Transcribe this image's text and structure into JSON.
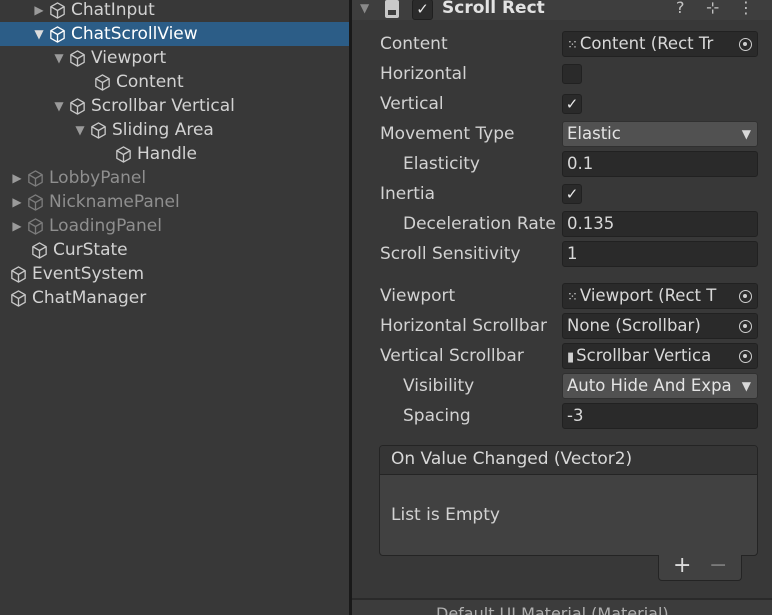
{
  "hierarchy": {
    "items": [
      {
        "label": "ChatInput",
        "state": "normal",
        "fold": "▶"
      },
      {
        "label": "ChatScrollView",
        "state": "selected",
        "fold": "▼"
      },
      {
        "label": "Viewport",
        "state": "normal",
        "fold": "▼"
      },
      {
        "label": "Content",
        "state": "normal",
        "fold": ""
      },
      {
        "label": "Scrollbar Vertical",
        "state": "normal",
        "fold": "▼"
      },
      {
        "label": "Sliding Area",
        "state": "normal",
        "fold": "▼"
      },
      {
        "label": "Handle",
        "state": "normal",
        "fold": ""
      },
      {
        "label": "LobbyPanel",
        "state": "inactive",
        "fold": "▶"
      },
      {
        "label": "NicknamePanel",
        "state": "inactive",
        "fold": "▶"
      },
      {
        "label": "LoadingPanel",
        "state": "inactive",
        "fold": "▶"
      },
      {
        "label": "CurState",
        "state": "normal",
        "fold": ""
      },
      {
        "label": "EventSystem",
        "state": "normal",
        "fold": ""
      },
      {
        "label": "ChatManager",
        "state": "normal",
        "fold": ""
      }
    ]
  },
  "inspector": {
    "component": {
      "title": "Scroll Rect",
      "fold": "▼",
      "enabled_mark": "✓",
      "help_glyph": "?",
      "preset_glyph": "⊹",
      "menu_glyph": "⋮"
    },
    "props": {
      "content": {
        "label": "Content",
        "value": "Content (Rect Tr",
        "ref_glyph": "⁙"
      },
      "horizontal": {
        "label": "Horizontal",
        "mark": ""
      },
      "vertical": {
        "label": "Vertical",
        "mark": "✓"
      },
      "movement_type": {
        "label": "Movement Type",
        "value": "Elastic",
        "arrow": "▼"
      },
      "elasticity": {
        "label": "Elasticity",
        "value": "0.1"
      },
      "inertia": {
        "label": "Inertia",
        "mark": "✓"
      },
      "deceleration_rate": {
        "label": "Deceleration Rate",
        "value": "0.135"
      },
      "scroll_sensitivity": {
        "label": "Scroll Sensitivity",
        "value": "1"
      },
      "viewport": {
        "label": "Viewport",
        "value": "Viewport (Rect T",
        "ref_glyph": "⁙"
      },
      "horizontal_scrollbar": {
        "label": "Horizontal Scrollbar",
        "value": "None (Scrollbar)"
      },
      "vertical_scrollbar": {
        "label": "Vertical Scrollbar",
        "value": "Scrollbar Vertica",
        "ref_glyph": "▮"
      },
      "visibility": {
        "label": "Visibility",
        "value": "Auto Hide And Expa",
        "arrow": "▼"
      },
      "spacing": {
        "label": "Spacing",
        "value": "-3"
      }
    },
    "event": {
      "title": "On Value Changed (Vector2)",
      "empty_text": "List is Empty",
      "add_glyph": "+",
      "remove_glyph": "−"
    },
    "next_component_partial": "Default UI Material (Material)"
  },
  "colors": {
    "background": "#383838",
    "selection": "#2c5d87",
    "field": "#2a2a2a",
    "text": "#d2d2d2",
    "inactive_text": "#8f8f8f"
  }
}
